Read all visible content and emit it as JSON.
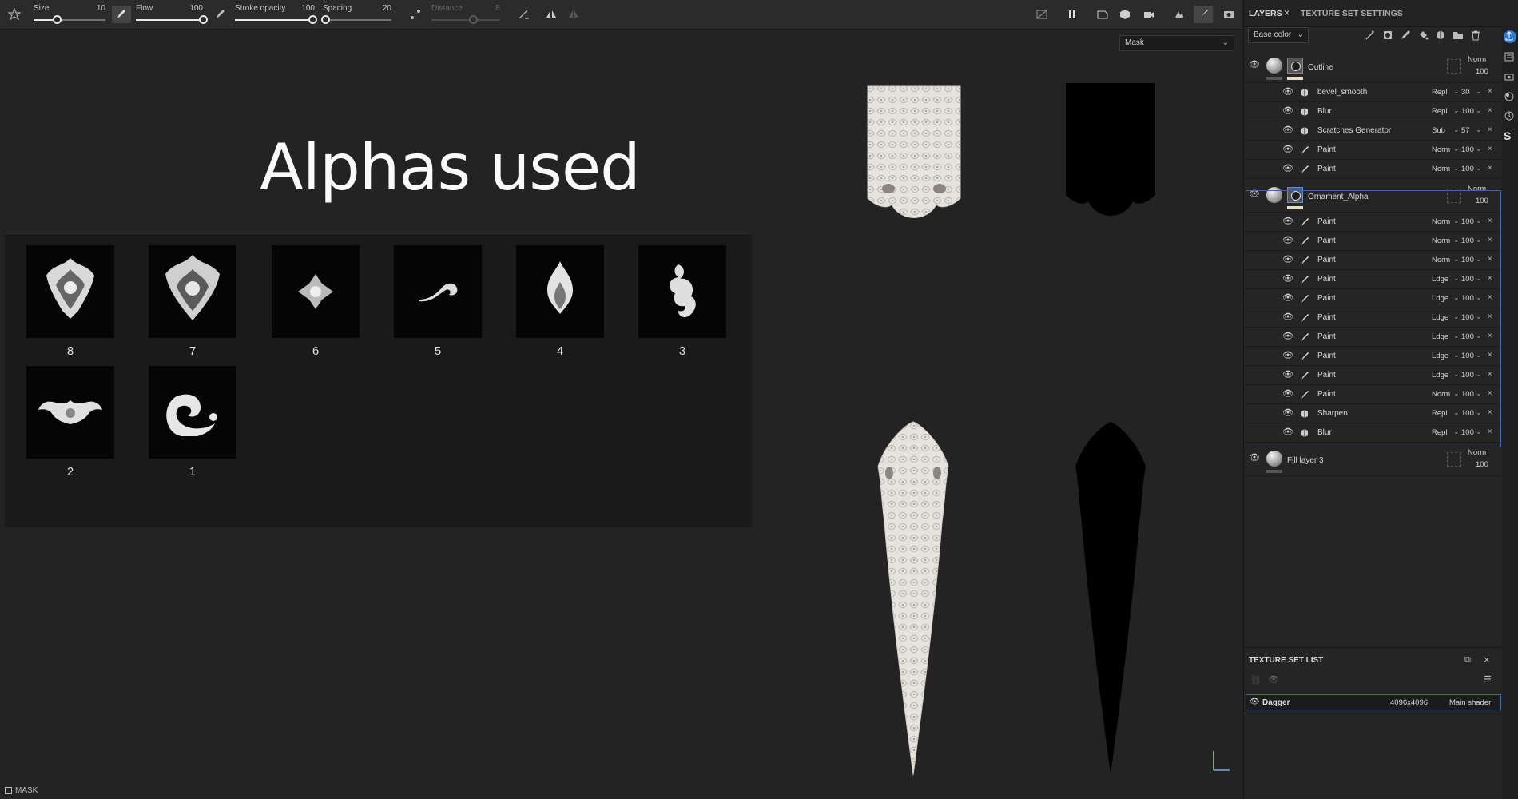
{
  "toolbar": {
    "size_label": "Size",
    "size_value": "10",
    "flow_label": "Flow",
    "flow_value": "100",
    "stroke_opacity_label": "Stroke opacity",
    "stroke_opacity_value": "100",
    "spacing_label": "Spacing",
    "spacing_value": "20",
    "distance_label": "Distance",
    "distance_value": "8"
  },
  "viewport": {
    "mask_select_value": "Mask",
    "title": "Alphas used",
    "alphas": [
      {
        "label": "8"
      },
      {
        "label": "7"
      },
      {
        "label": "6"
      },
      {
        "label": "5"
      },
      {
        "label": "4"
      },
      {
        "label": "3"
      },
      {
        "label": "2"
      },
      {
        "label": "1"
      }
    ],
    "status_label": "MASK"
  },
  "layers_panel": {
    "tab_layers": "LAYERS",
    "tab_texture_set_settings": "TEXTURE SET SETTINGS",
    "channel_select": "Base color",
    "groups": [
      {
        "name": "Outline",
        "blend": "Norm",
        "opacity": "100",
        "children": [
          {
            "name": "bevel_smooth",
            "blend": "Repl",
            "opacity": "30"
          },
          {
            "name": "Blur",
            "blend": "Repl",
            "opacity": "100"
          },
          {
            "name": "Scratches Generator",
            "blend": "Sub",
            "opacity": "57"
          },
          {
            "name": "Paint",
            "blend": "Norm",
            "opacity": "100"
          },
          {
            "name": "Paint",
            "blend": "Norm",
            "opacity": "100"
          }
        ]
      },
      {
        "name": "Ornament_Alpha",
        "blend": "Norm",
        "opacity": "100",
        "children": [
          {
            "name": "Paint",
            "blend": "Norm",
            "opacity": "100"
          },
          {
            "name": "Paint",
            "blend": "Norm",
            "opacity": "100"
          },
          {
            "name": "Paint",
            "blend": "Norm",
            "opacity": "100"
          },
          {
            "name": "Paint",
            "blend": "Ldge",
            "opacity": "100"
          },
          {
            "name": "Paint",
            "blend": "Ldge",
            "opacity": "100"
          },
          {
            "name": "Paint",
            "blend": "Ldge",
            "opacity": "100"
          },
          {
            "name": "Paint",
            "blend": "Ldge",
            "opacity": "100"
          },
          {
            "name": "Paint",
            "blend": "Ldge",
            "opacity": "100"
          },
          {
            "name": "Paint",
            "blend": "Ldge",
            "opacity": "100"
          },
          {
            "name": "Paint",
            "blend": "Norm",
            "opacity": "100"
          },
          {
            "name": "Sharpen",
            "blend": "Repl",
            "opacity": "100"
          },
          {
            "name": "Blur",
            "blend": "Repl",
            "opacity": "100"
          }
        ]
      },
      {
        "name": "Fill layer 3",
        "blend": "Norm",
        "opacity": "100",
        "children": []
      }
    ]
  },
  "texture_set_list": {
    "title": "TEXTURE SET LIST",
    "rows": [
      {
        "name": "Dagger",
        "resolution": "4096x4096",
        "shader": "Main shader"
      }
    ]
  }
}
